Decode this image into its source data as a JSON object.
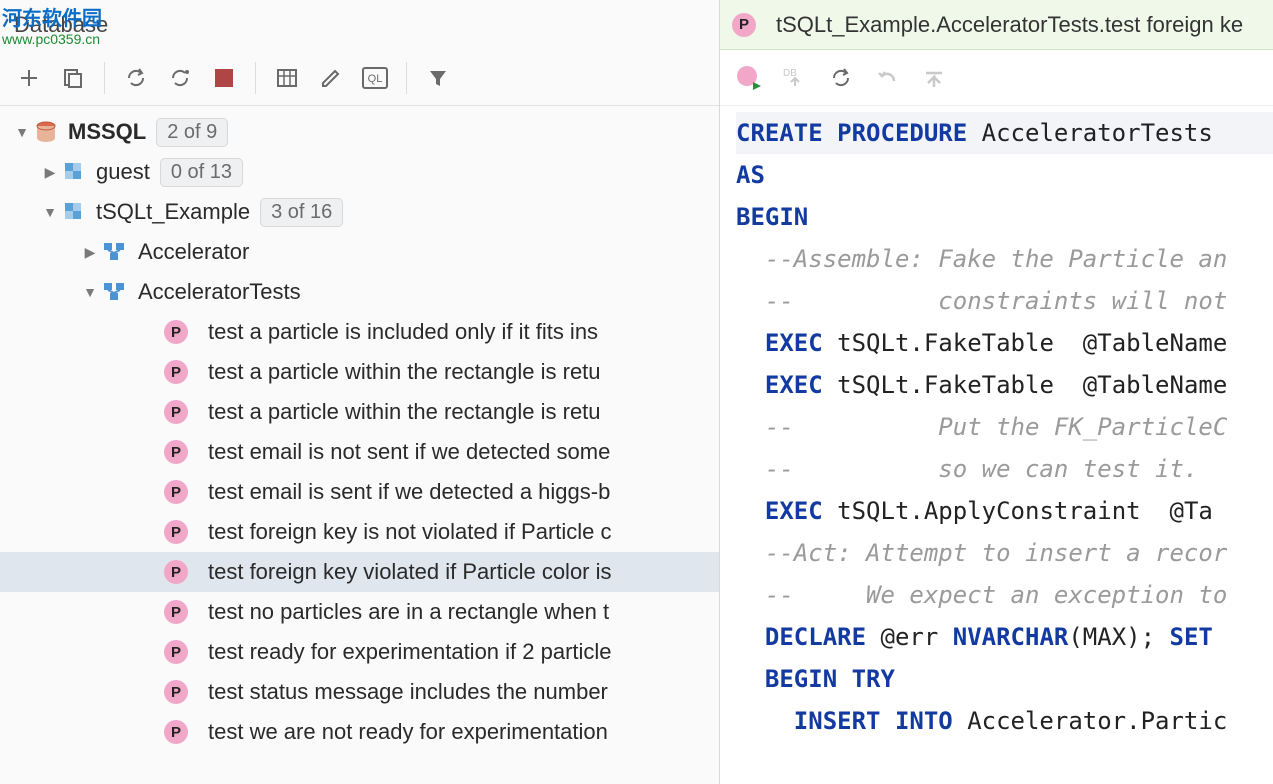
{
  "watermark": {
    "title": "河东软件园",
    "url": "www.pc0359.cn"
  },
  "left": {
    "title": "Database",
    "tree": {
      "root": {
        "label": "MSSQL",
        "badge": "2 of 9"
      },
      "schemas": [
        {
          "label": "guest",
          "badge": "0 of 13",
          "expanded": false
        },
        {
          "label": "tSQLt_Example",
          "badge": "3 of 16",
          "expanded": true
        }
      ],
      "subnodes": [
        {
          "label": "Accelerator",
          "expanded": false
        },
        {
          "label": "AcceleratorTests",
          "expanded": true
        }
      ],
      "procs": [
        "test a particle is included only if it fits ins",
        "test a particle within the rectangle is retu",
        "test a particle within the rectangle is retu",
        "test email is not sent if we detected some",
        "test email is sent if we detected a higgs-b",
        "test foreign key is not violated if Particle c",
        "test foreign key violated if Particle color is",
        "test no particles are in a rectangle when t",
        "test ready for experimentation if 2 particle",
        "test status message includes the number",
        "test we are not ready for experimentation"
      ],
      "selected_index": 6
    }
  },
  "right": {
    "tab": {
      "label": "tSQLt_Example.AcceleratorTests.test foreign ke"
    },
    "code": [
      {
        "hl": true,
        "seg": [
          [
            "kw",
            "CREATE PROCEDURE "
          ],
          [
            "",
            "AcceleratorTests"
          ]
        ]
      },
      {
        "seg": [
          [
            "kw",
            "AS"
          ]
        ]
      },
      {
        "seg": [
          [
            "kw",
            "BEGIN"
          ]
        ]
      },
      {
        "seg": [
          [
            "cm",
            "  --Assemble: Fake the Particle an"
          ]
        ]
      },
      {
        "seg": [
          [
            "cm",
            "  --          constraints will not"
          ]
        ]
      },
      {
        "seg": [
          [
            "kw",
            "  EXEC "
          ],
          [
            "",
            "tSQLt.FakeTable  @TableName"
          ]
        ]
      },
      {
        "seg": [
          [
            "kw",
            "  EXEC "
          ],
          [
            "",
            "tSQLt.FakeTable  @TableName"
          ]
        ]
      },
      {
        "seg": [
          [
            "cm",
            "  --          Put the FK_ParticleC"
          ]
        ]
      },
      {
        "seg": [
          [
            "cm",
            "  --          so we can test it."
          ]
        ]
      },
      {
        "seg": [
          [
            "kw",
            "  EXEC "
          ],
          [
            "",
            "tSQLt.ApplyConstraint  @Ta"
          ]
        ]
      },
      {
        "seg": [
          [
            "",
            ""
          ]
        ]
      },
      {
        "seg": [
          [
            "cm",
            "  --Act: Attempt to insert a recor"
          ]
        ]
      },
      {
        "seg": [
          [
            "cm",
            "  --     We expect an exception to"
          ]
        ]
      },
      {
        "seg": [
          [
            "kw",
            "  DECLARE "
          ],
          [
            "",
            "@err "
          ],
          [
            "kw",
            "NVARCHAR"
          ],
          [
            "",
            "(MAX); "
          ],
          [
            "kw",
            "SET"
          ]
        ]
      },
      {
        "seg": [
          [
            "kw",
            "  BEGIN TRY"
          ]
        ]
      },
      {
        "seg": [
          [
            "kw",
            "    INSERT INTO "
          ],
          [
            "",
            "Accelerator.Partic"
          ]
        ]
      }
    ]
  }
}
